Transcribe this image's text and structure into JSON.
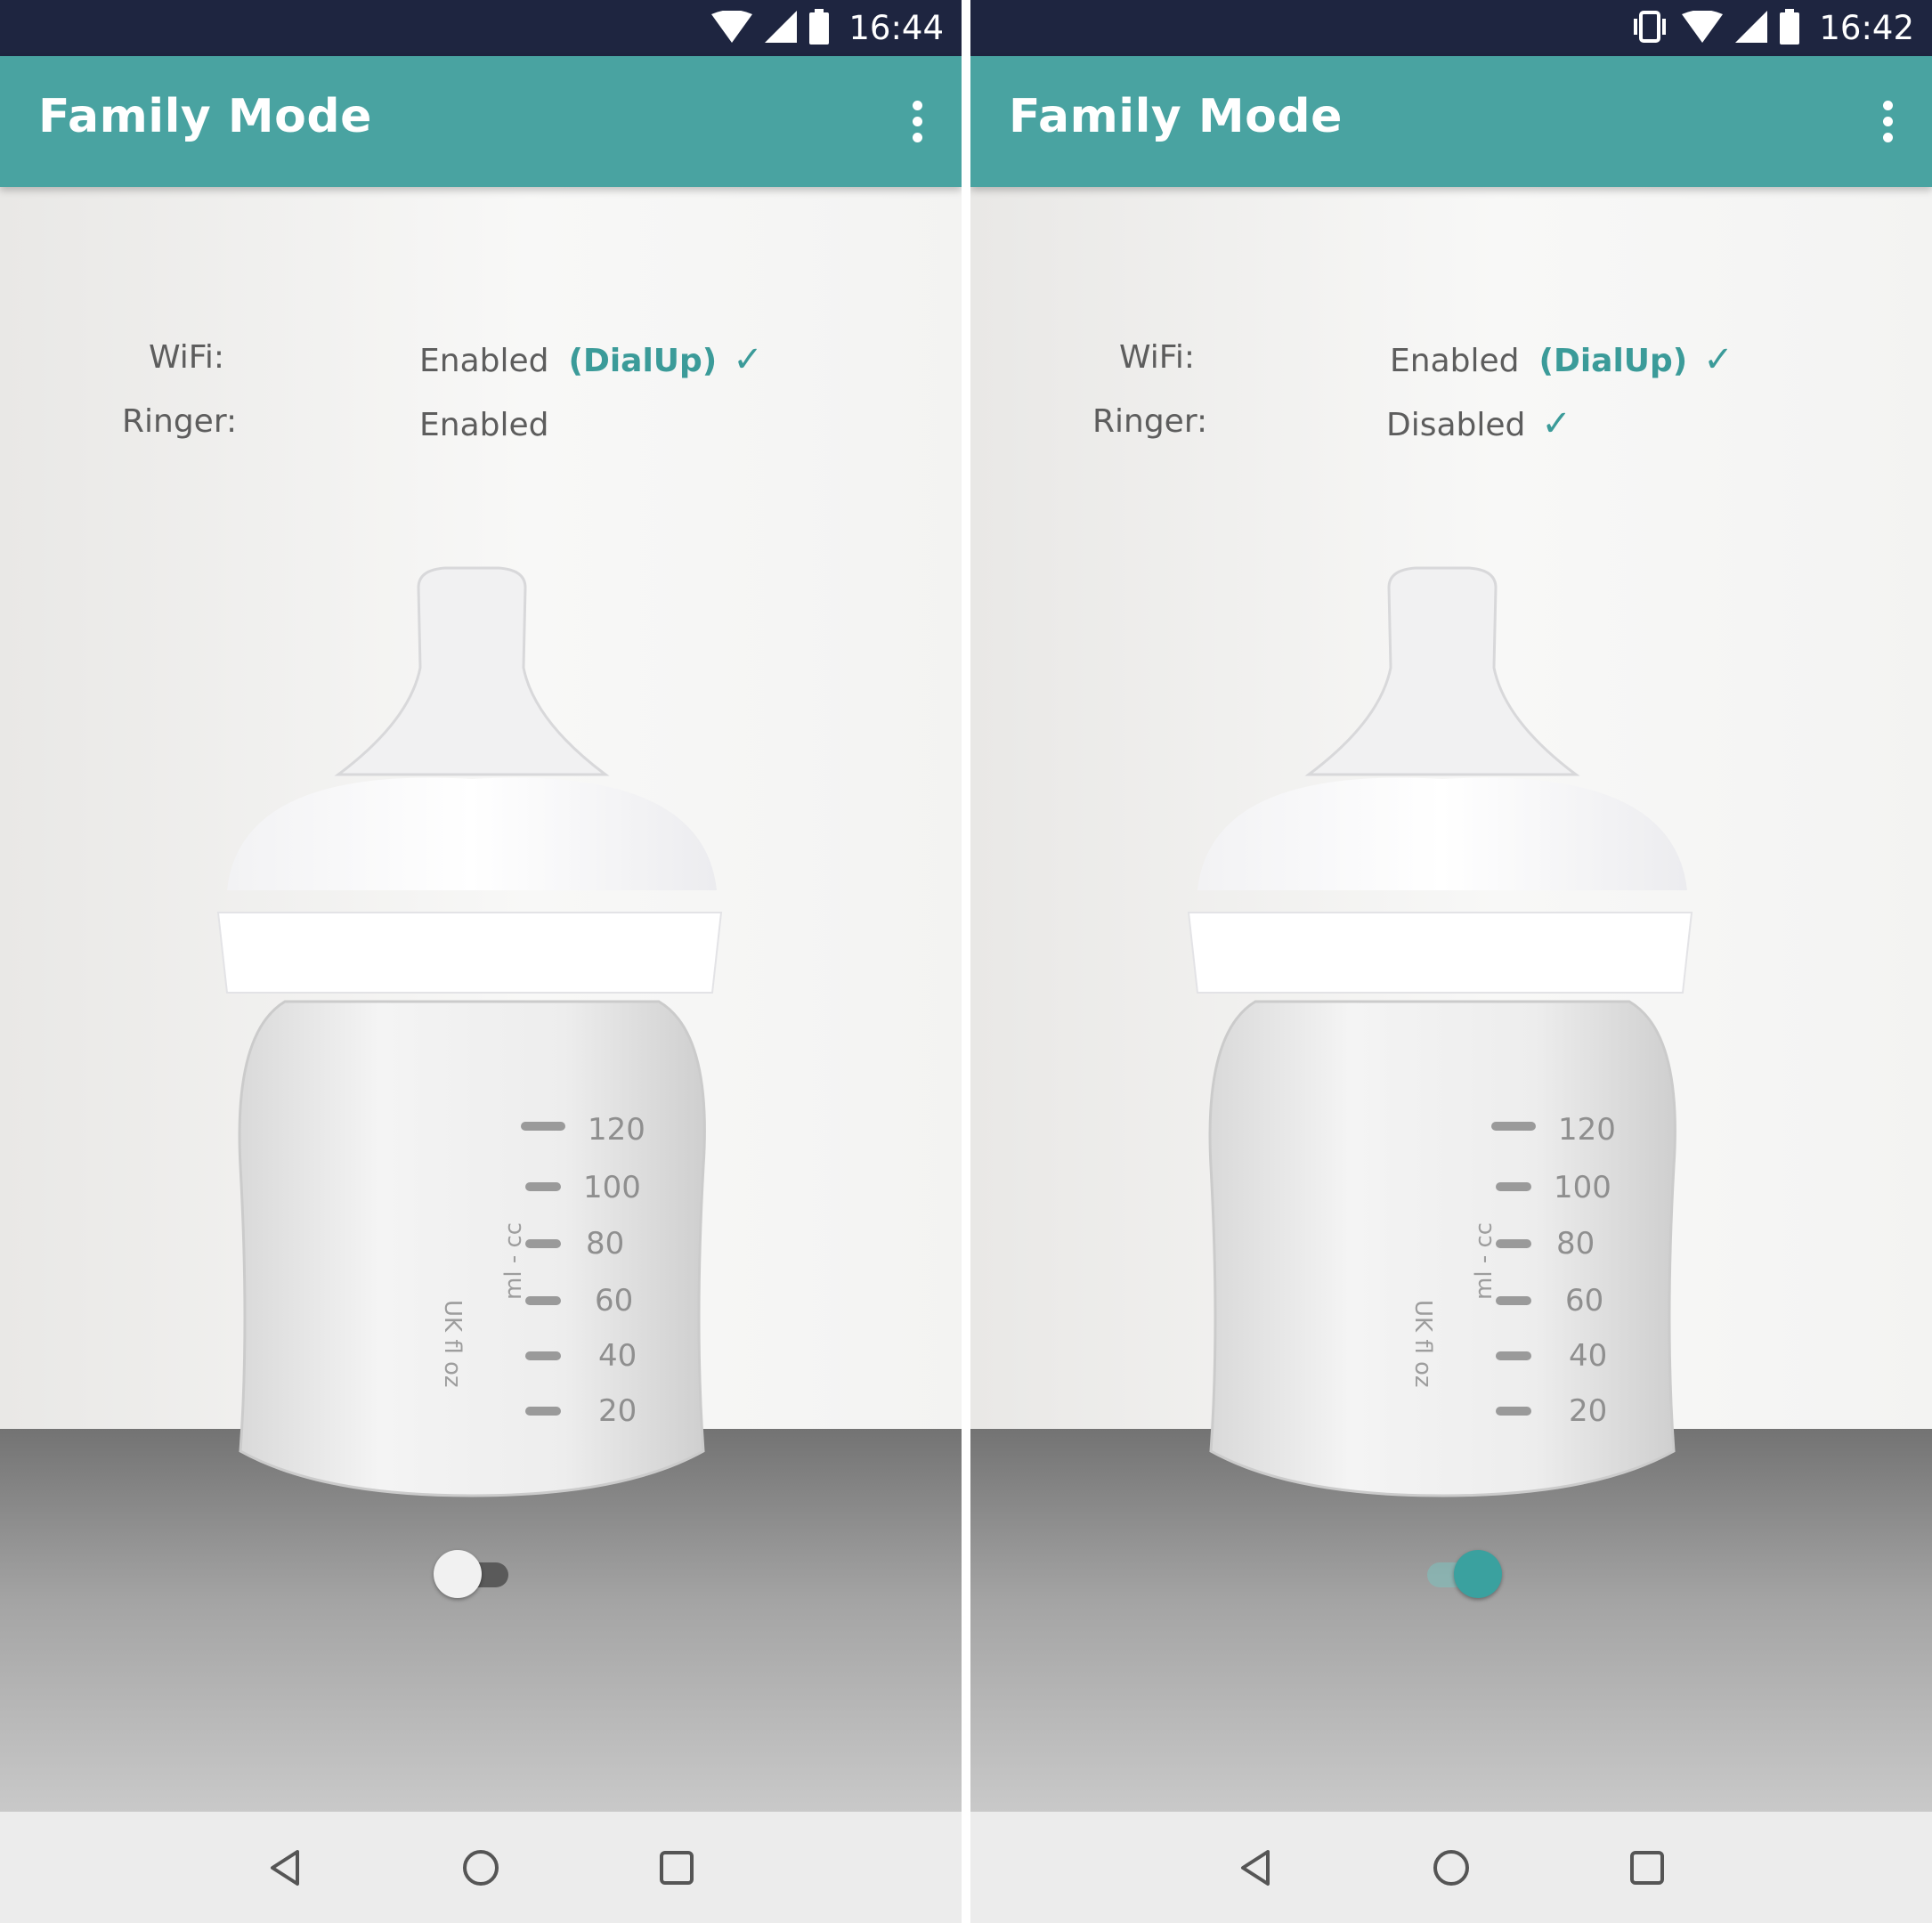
{
  "screens": [
    {
      "status_time": "16:44",
      "app_title": "Family Mode",
      "wifi_label": "WiFi:",
      "wifi_status": "Enabled",
      "wifi_network": "(DialUp)",
      "wifi_check": "✓",
      "ringer_label": "Ringer:",
      "ringer_status": "Enabled",
      "ringer_check": "",
      "toggle_on": false
    },
    {
      "status_time": "16:42",
      "app_title": "Family Mode",
      "wifi_label": "WiFi:",
      "wifi_status": "Enabled",
      "wifi_network": "(DialUp)",
      "wifi_check": "✓",
      "ringer_label": "Ringer:",
      "ringer_status": "Disabled",
      "ringer_check": "✓",
      "toggle_on": true
    }
  ],
  "bottle_markings": [
    "120",
    "100",
    "80",
    "60",
    "40",
    "20"
  ],
  "bottle_side_text": [
    "ml - cc",
    "UK fl oz"
  ],
  "colors": {
    "accent": "#49a3a1",
    "status_bar": "#1e2540",
    "check": "#3b9b99"
  },
  "icons": [
    "wifi-icon",
    "cell-signal-icon",
    "battery-icon",
    "vibrate-icon",
    "overflow-menu-icon",
    "back-icon",
    "home-icon",
    "recents-icon"
  ]
}
